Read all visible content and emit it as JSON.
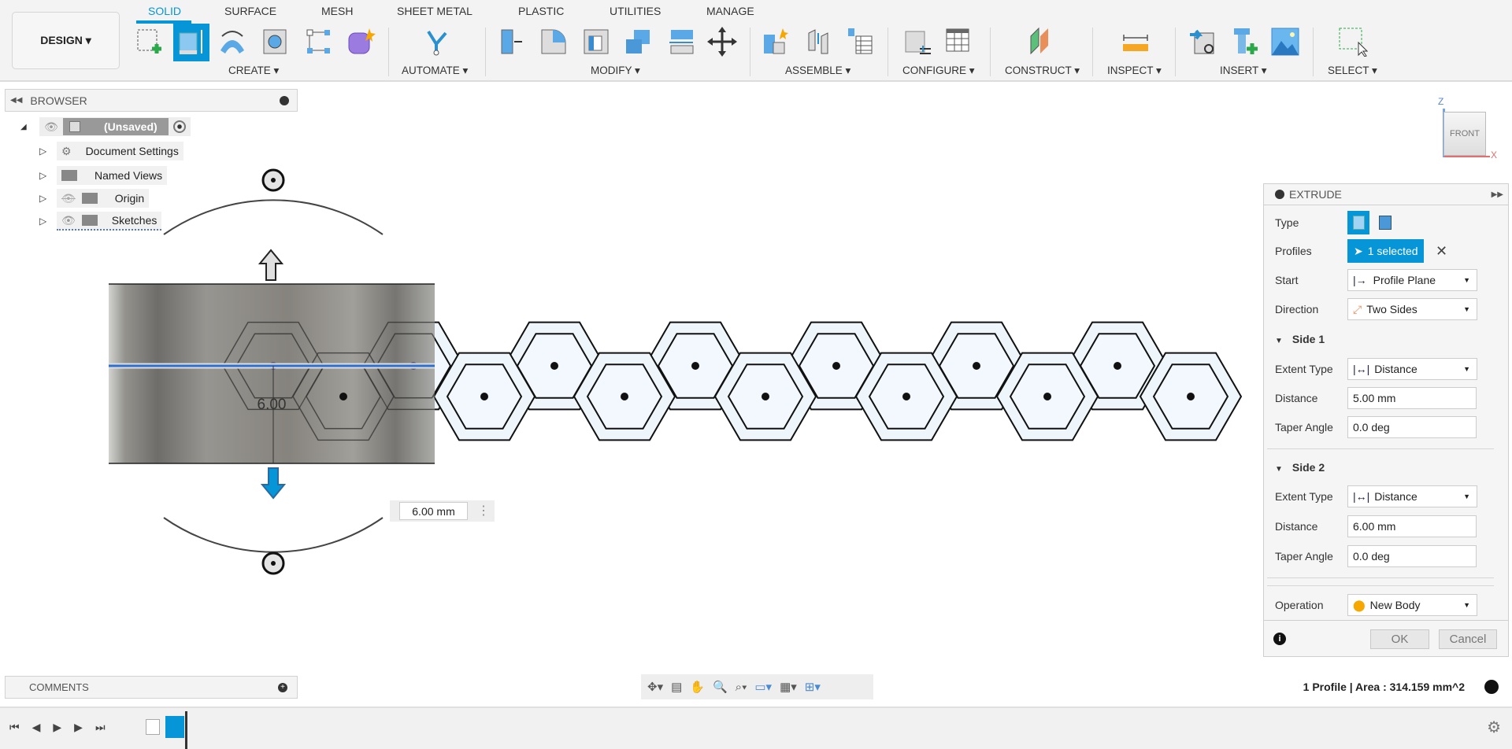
{
  "toolbar": {
    "workspace": "DESIGN ▾",
    "tabs": [
      "SOLID",
      "SURFACE",
      "MESH",
      "SHEET METAL",
      "PLASTIC",
      "UTILITIES",
      "MANAGE"
    ],
    "active_tab": "SOLID",
    "groups": [
      "CREATE ▾",
      "AUTOMATE ▾",
      "MODIFY ▾",
      "ASSEMBLE ▾",
      "CONFIGURE ▾",
      "CONSTRUCT ▾",
      "INSPECT ▾",
      "INSERT ▾",
      "SELECT ▾"
    ],
    "accent": "#0696d7"
  },
  "browser": {
    "title": "BROWSER",
    "root": "(Unsaved)",
    "items": [
      "Document Settings",
      "Named Views",
      "Origin",
      "Sketches"
    ]
  },
  "viewport": {
    "dimension_label": "6.00",
    "distance_input": "6.00 mm",
    "viewcube": {
      "face": "FRONT",
      "z": "Z",
      "x": "X"
    }
  },
  "extrude": {
    "title": "EXTRUDE",
    "type_label": "Type",
    "profiles_label": "Profiles",
    "profiles_value": "1 selected",
    "start_label": "Start",
    "start_value": "Profile Plane",
    "direction_label": "Direction",
    "direction_value": "Two Sides",
    "side1": {
      "title": "Side 1",
      "extent_label": "Extent Type",
      "extent_value": "Distance",
      "distance_label": "Distance",
      "distance_value": "5.00 mm",
      "taper_label": "Taper Angle",
      "taper_value": "0.0 deg"
    },
    "side2": {
      "title": "Side 2",
      "extent_label": "Extent Type",
      "extent_value": "Distance",
      "distance_label": "Distance",
      "distance_value": "6.00 mm",
      "taper_label": "Taper Angle",
      "taper_value": "0.0 deg"
    },
    "operation_label": "Operation",
    "operation_value": "New Body",
    "ok": "OK",
    "cancel": "Cancel"
  },
  "comments": {
    "title": "COMMENTS"
  },
  "status": {
    "text": "1 Profile | Area : 314.159 mm^2"
  }
}
